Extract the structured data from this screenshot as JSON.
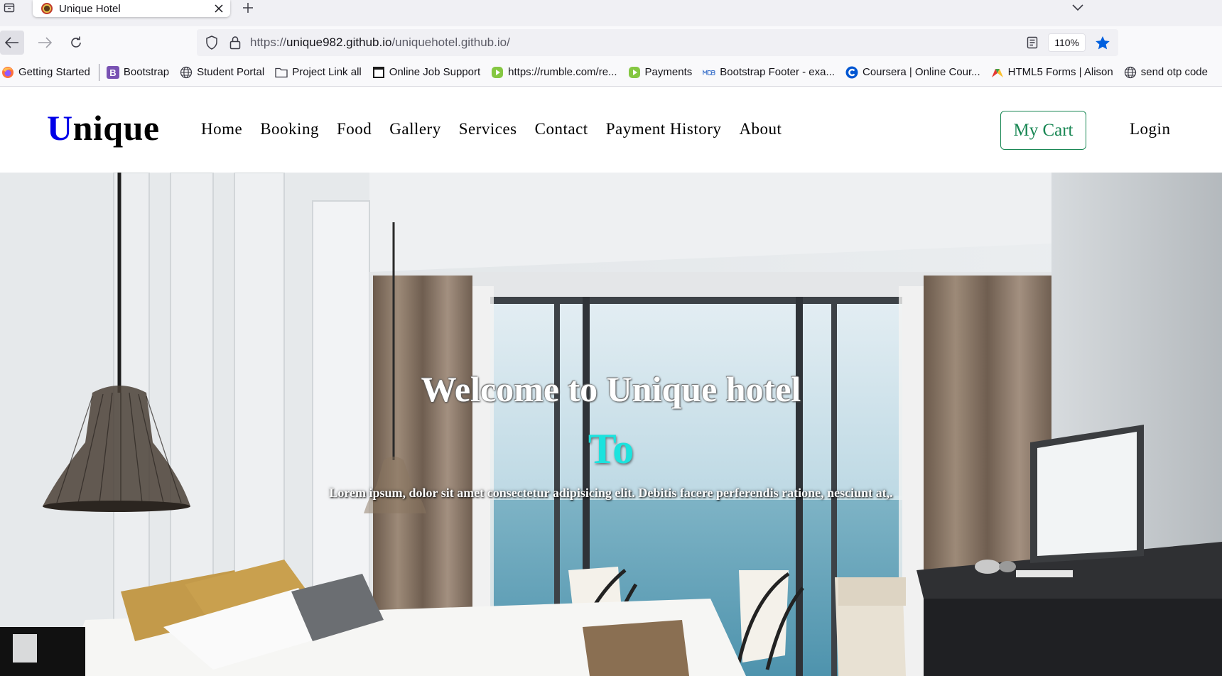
{
  "browser": {
    "tab_title": "Unique Hotel",
    "url_scheme": "https://",
    "url_host": "unique982.github.io",
    "url_path": "/uniquehotel.github.io/",
    "zoom": "110%"
  },
  "bookmarks": [
    {
      "label": "Getting Started",
      "icon": "firefox-icon"
    },
    {
      "label": "Bootstrap",
      "icon": "bootstrap-icon"
    },
    {
      "label": "Student Portal",
      "icon": "globe-icon"
    },
    {
      "label": "Project Link all",
      "icon": "folder-icon"
    },
    {
      "label": "Online Job Support",
      "icon": "page-icon"
    },
    {
      "label": "https://rumble.com/re...",
      "icon": "rumble-icon"
    },
    {
      "label": "Payments",
      "icon": "rumble-icon"
    },
    {
      "label": "Bootstrap Footer - exa...",
      "icon": "mdb-icon"
    },
    {
      "label": "Coursera | Online Cour...",
      "icon": "coursera-icon"
    },
    {
      "label": "HTML5 Forms | Alison",
      "icon": "alison-icon"
    },
    {
      "label": "send otp code",
      "icon": "globe-icon"
    }
  ],
  "site": {
    "brand_first": "U",
    "brand_rest": "nique",
    "nav": [
      "Home",
      "Booking",
      "Food",
      "Gallery",
      "Services",
      "Contact",
      "Payment History",
      "About"
    ],
    "cart_label": "My Cart",
    "login_label": "Login"
  },
  "hero": {
    "title": "Welcome to Unique hotel",
    "subtitle": "To",
    "description": "Lorem ipsum, dolor sit amet consectetur adipisicing elit. Debitis facere perferendis ratione, nesciunt at,."
  },
  "colors": {
    "brand_accent": "#0000e8",
    "cart_green": "#198754",
    "hero_subtitle": "#1be3de",
    "bookmark_star": "#0060df"
  }
}
